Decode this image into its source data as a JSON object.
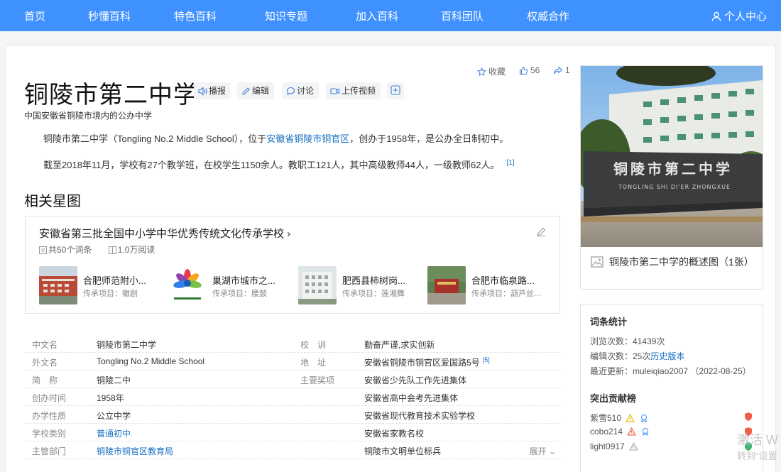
{
  "nav": {
    "items": [
      "首页",
      "秒懂百科",
      "特色百科",
      "知识专题",
      "加入百科",
      "百科团队",
      "权威合作"
    ],
    "user_label": "个人中心"
  },
  "entry": {
    "title": "铜陵市第二中学",
    "tools": {
      "broadcast": "播报",
      "edit": "编辑",
      "discuss": "讨论",
      "upload_video": "上传视频"
    },
    "collect": "收藏",
    "likes": "56",
    "shares": "1",
    "subtitle": "中国安徽省铜陵市境内的公办中学",
    "para1_a": "铜陵市第二中学（Tongling No.2 Middle School），位于",
    "para1_link": "安徽省铜陵市铜官区",
    "para1_b": "，创办于1958年，是公办全日制初中。",
    "para2": "截至2018年11月，学校有27个教学班，在校学生1150余人。教职工121人，其中高级教师44人，一级教师62人。",
    "para2_ref": "[1]"
  },
  "related": {
    "heading": "相关星图",
    "card_title": "安徽省第三批全国中小学中华优秀传统文化传承学校",
    "entries_count": "共50个词条",
    "reads": "1.0万阅读",
    "items": [
      {
        "name": "合肥师范附小...",
        "sub": "传承项目：徽剧"
      },
      {
        "name": "巢湖市城市之...",
        "sub": "传承项目：腰鼓"
      },
      {
        "name": "肥西县柿树岗...",
        "sub": "传承项目：莲湘舞"
      },
      {
        "name": "合肥市临泉路...",
        "sub": "传承项目：葫芦丝..."
      }
    ]
  },
  "infobox": {
    "left": [
      {
        "k": "中文名",
        "v": "铜陵市第二中学"
      },
      {
        "k": "外文名",
        "v": "Tongling No.2 Middle School"
      },
      {
        "k": "简　称",
        "v": "铜陵二中"
      },
      {
        "k": "创办时间",
        "v": "1958年"
      },
      {
        "k": "办学性质",
        "v": "公立中学"
      },
      {
        "k": "学校类别",
        "v": "普通初中"
      },
      {
        "k": "主管部门",
        "v": "铜陵市铜官区教育局"
      }
    ],
    "right": [
      {
        "k": "校　训",
        "v": "勤奋严谨,求实创新"
      },
      {
        "k": "地　址",
        "v": "安徽省铜陵市铜官区爱国路5号",
        "ref": "[5]"
      },
      {
        "k": "主要奖项",
        "v": "安徽省少先队工作先进集体"
      },
      {
        "k": "",
        "v": "安徽省高中会考先进集体"
      },
      {
        "k": "",
        "v": "安徽省现代教育技术实验学校"
      },
      {
        "k": "",
        "v": "安徽省家教名校"
      },
      {
        "k": "",
        "v": "铜陵市文明单位标兵"
      }
    ],
    "expand": "展开"
  },
  "sidebar": {
    "photo_caption": "铜陵市第二中学的概述图（1张）",
    "sign_main": "铜陵市第二中学",
    "sign_sub": "TONGLING SHI DI'ER ZHONGXUE",
    "stats_title": "词条统计",
    "views": "浏览次数：41439次",
    "edits_prefix": "编辑次数：25次",
    "edits_link": "历史版本",
    "last_update": "最近更新：muleiqiao2007 （2022-08-25）",
    "contrib_title": "突出贡献榜",
    "contributors": [
      "紫雪510",
      "cobo214",
      "light0917"
    ]
  },
  "watermark": {
    "line1": "激活 W",
    "line2": "转到\"设置"
  },
  "colors": {
    "nav_bg": "#3f91ff",
    "link": "#136ec2"
  }
}
